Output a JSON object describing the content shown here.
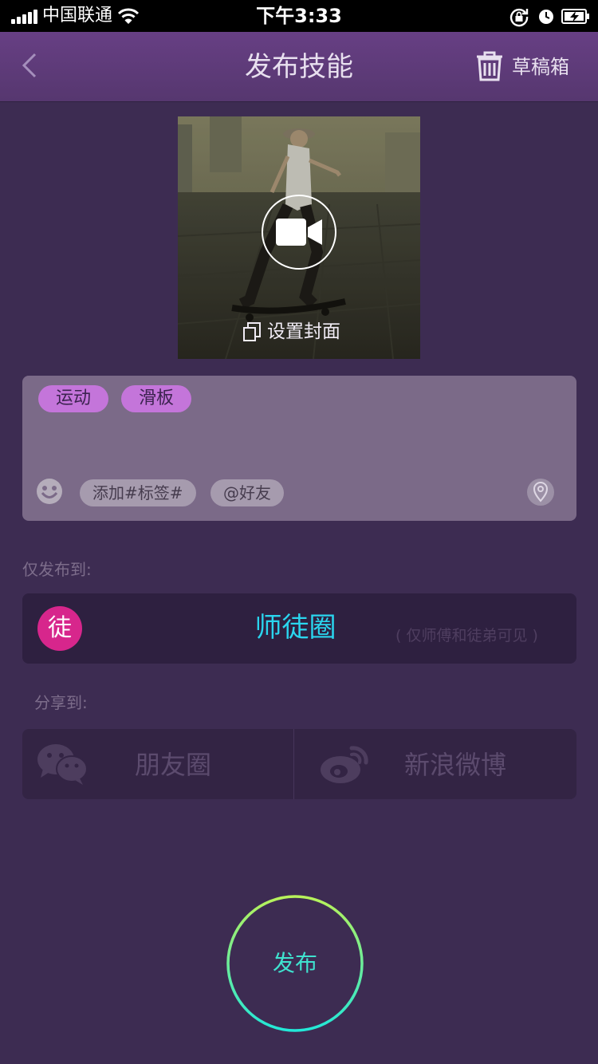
{
  "status_bar": {
    "carrier": "中国联通",
    "time": "下午3:33",
    "icons": [
      "signal-icon",
      "wifi-icon",
      "rotation-lock-icon",
      "alarm-clock-icon",
      "battery-charging-icon"
    ]
  },
  "nav": {
    "title": "发布技能",
    "back_icon": "chevron-left-icon",
    "drafts_label": "草稿箱",
    "drafts_icon": "trash-icon"
  },
  "cover": {
    "video_icon": "video-camera-icon",
    "set_cover_label": "设置封面",
    "set_cover_icon": "copy-frame-icon"
  },
  "editor": {
    "tags": [
      "运动",
      "滑板"
    ],
    "emoji_icon": "smiley-icon",
    "add_topic_label": "添加#标签#",
    "mention_label": "@好友",
    "location_icon": "location-pin-icon"
  },
  "publish_to": {
    "label": "仅发布到:",
    "badge": "徒",
    "name": "师徒圈",
    "note": "( 仅师傅和徒弟可见 )"
  },
  "share": {
    "label": "分享到:",
    "wechat_label": "朋友圈",
    "weibo_label": "新浪微博",
    "wechat_icon": "wechat-icon",
    "weibo_icon": "weibo-icon"
  },
  "publish_button": {
    "label": "发布"
  },
  "colors": {
    "background": "#3d2c52",
    "nav": "#673f84",
    "accent_cyan": "#2ad5ee",
    "tag_purple": "#c475da",
    "badge_pink": "#d7268c",
    "publish_ring_start": "#b8f25a",
    "publish_ring_end": "#22e8d8"
  }
}
